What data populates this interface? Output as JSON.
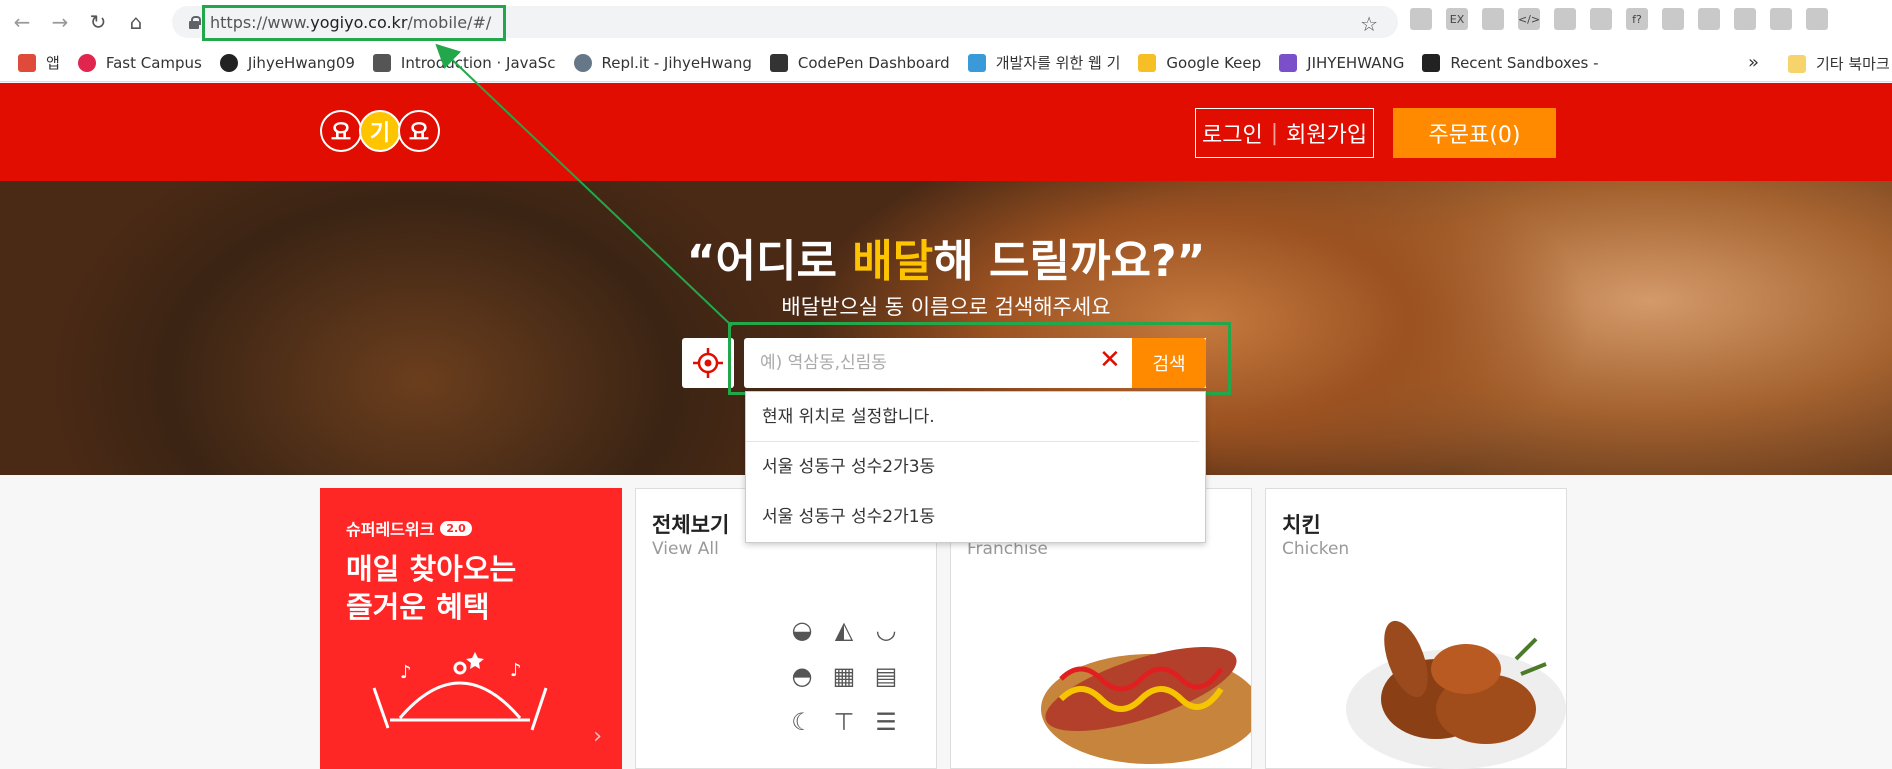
{
  "browser": {
    "url_prefix": "https://www.",
    "url_host": "yogiyo.co.kr",
    "url_path": "/mobile/#/",
    "extensions": [
      "",
      "EX",
      "",
      "</>",
      "",
      "",
      "f?",
      "",
      "",
      "",
      "",
      ""
    ]
  },
  "bookmarks": [
    {
      "label": "앱",
      "color": "#e04a3a"
    },
    {
      "label": "Fast Campus",
      "color": "#e0254f"
    },
    {
      "label": "JihyeHwang09",
      "color": "#222222"
    },
    {
      "label": "Introduction · JavaSc",
      "color": "#555555"
    },
    {
      "label": "Repl.it - JihyeHwang",
      "color": "#667788"
    },
    {
      "label": "CodePen Dashboard",
      "color": "#333333"
    },
    {
      "label": "개발자를 위한 웹 기",
      "color": "#3a9ad9"
    },
    {
      "label": "Google Keep",
      "color": "#f6bf26"
    },
    {
      "label": "JIHYEHWANG",
      "color": "#7b4fc9"
    },
    {
      "label": "Recent Sandboxes -",
      "color": "#222222"
    }
  ],
  "bookmarks_more": "»",
  "bookmarks_folder": "기타 북마크",
  "site": {
    "logo_chars": [
      "요",
      "기",
      "요"
    ],
    "login": "로그인",
    "signup": "회원가입",
    "order": "주문표(0)"
  },
  "hero": {
    "title_open": "“어디로 ",
    "title_accent": "배달",
    "title_close": "해 드릴까요?”",
    "subtitle": "배달받으실 동 이름으로 검색해주세요",
    "search_placeholder": "예) 역삼동,신림동",
    "search_button": "검색",
    "clear": "✕"
  },
  "suggestions": [
    "현재 위치로 설정합니다.",
    "서울 성동구 성수2가3동",
    "서울 성동구 성수2가1동"
  ],
  "cards": {
    "promo_tag": "슈퍼레드위크",
    "promo_ver": "2.0",
    "promo_line1": "매일 찾아오는",
    "promo_line2": "즐거운 혜택",
    "all_title": "전체보기",
    "all_sub": "View All",
    "franchise_sub": "Franchise",
    "chicken_title": "치킨",
    "chicken_sub": "Chicken"
  },
  "colors": {
    "brand_red": "#e00d00",
    "brand_orange": "#ff8a00",
    "brand_yellow": "#ffc400",
    "annotation_green": "#22a84a"
  }
}
